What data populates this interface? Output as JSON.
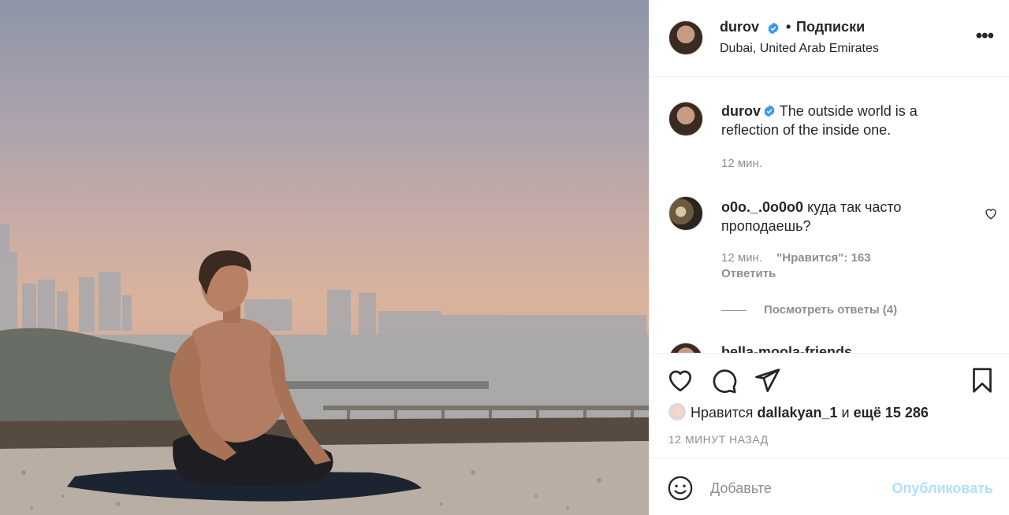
{
  "post": {
    "username": "durov",
    "separator": "•",
    "follow_label": "Подписки",
    "location": "Dubai, United Arab Emirates",
    "more_icon": "more-horizontal-icon"
  },
  "caption": {
    "username": "durov",
    "text": "The outside world is a reflection of the inside one.",
    "time": "12 мин."
  },
  "comment": {
    "username": "o0o._.0o0o0",
    "text": "куда так часто проподаешь?",
    "time": "12 мин.",
    "likes": "\"Нравится\": 163",
    "reply_label": "Ответить",
    "view_replies": "Посмотреть ответы (4)"
  },
  "partial_comment": {
    "text": "bella-moola-friends"
  },
  "likes": {
    "prefix": "Нравится",
    "user": "dallakyan_1",
    "and": "и",
    "rest": "ещё 15 286"
  },
  "time_ago": "12 МИНУТ НАЗАД",
  "add_comment": {
    "placeholder": "Добавьте",
    "publish_label": "Опубликовать"
  },
  "colors": {
    "verified": "#3897f0",
    "publish_disabled": "#b2dffc",
    "meta": "#8e8e8e"
  }
}
